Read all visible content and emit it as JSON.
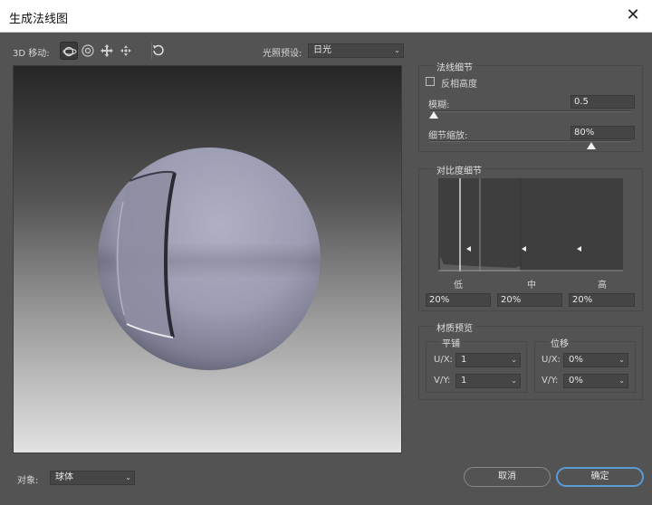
{
  "window": {
    "title": "生成法线图",
    "close_glyph": "✕"
  },
  "toolbar": {
    "move_label": "3D 移动:",
    "light_preset_label": "光照预设:",
    "light_preset_value": "日光",
    "icons": [
      "orbit-icon",
      "rotate-icon",
      "pan-icon",
      "slide-icon",
      "reset-view-icon"
    ]
  },
  "normal_detail": {
    "title": "法线细节",
    "invert_height_label": "反相高度",
    "invert_height_checked": false,
    "blur_label": "模糊:",
    "blur_value": "0.5",
    "blur_level": 0.02,
    "detail_scale_label": "细节缩放:",
    "detail_scale_value": "80%",
    "detail_scale_level": 0.8
  },
  "contrast_detail": {
    "title": "对比度细节",
    "low_label": "低",
    "mid_label": "中",
    "high_label": "高",
    "low_value": "20%",
    "mid_value": "20%",
    "high_value": "20%"
  },
  "material_preview": {
    "title": "材质预览",
    "tile": {
      "title": "平铺",
      "ux_label": "U/X:",
      "ux_value": "1",
      "vy_label": "V/Y:",
      "vy_value": "1"
    },
    "offset": {
      "title": "位移",
      "ux_label": "U/X:",
      "ux_value": "0%",
      "vy_label": "V/Y:",
      "vy_value": "0%"
    }
  },
  "footer": {
    "object_label": "对象:",
    "object_value": "球体",
    "cancel_label": "取消",
    "ok_label": "确定"
  },
  "colors": {
    "accent": "#5a9bd6",
    "panel": "#535353",
    "field": "#454545"
  }
}
